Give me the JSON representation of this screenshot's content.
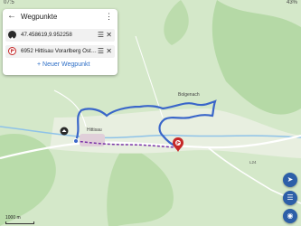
{
  "status": {
    "time": "07:5",
    "battery": "43%"
  },
  "panel": {
    "title": "Wegpunkte",
    "waypoints": [
      {
        "label": "47.458619,9.952258",
        "icon": "start-marker-icon"
      },
      {
        "label": "6952 Hittisau Vorarlberg Öst…",
        "icon": "destination-marker-icon"
      }
    ],
    "add_label": "+ Neuer Wegpunkt"
  },
  "map": {
    "places": [
      "Bolgenach",
      "Hittisau"
    ],
    "road_label": "L24",
    "route_color": "#3a66c9",
    "route_alt_color": "#7a32a8",
    "scale_label": "1000 m"
  },
  "colors": {
    "accent": "#2d5fa8",
    "destination_marker": "#c62828"
  }
}
